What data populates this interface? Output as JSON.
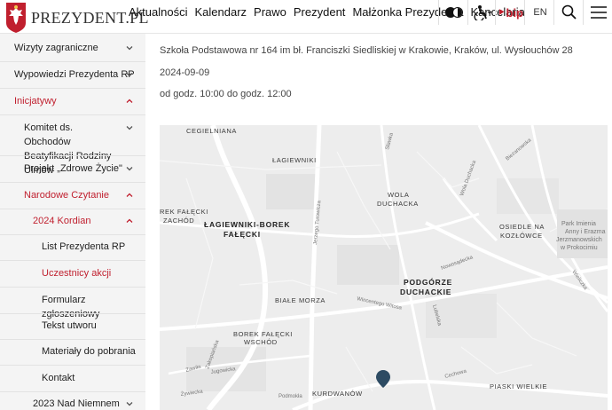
{
  "header": {
    "logo_text": "PREZYDENT.PL",
    "nav": [
      "Aktualności",
      "Kalendarz",
      "Prawo",
      "Prezydent",
      "Małżonka Prezydenta",
      "Kancelaria"
    ],
    "tools": {
      "contrast_icon": "contrast-toggle-icon",
      "accessibility_icon": "accessibility-icon",
      "bip_label": "bip",
      "lang_label": "EN",
      "search_icon": "search-icon",
      "menu_icon": "hamburger-menu-icon"
    },
    "brand_color": "#c01f2e"
  },
  "sidebar": {
    "items": [
      {
        "label": "Wizyty zagraniczne",
        "active": false,
        "chevron": "down"
      },
      {
        "label": "Wypowiedzi Prezydenta RP",
        "active": false,
        "chevron": "down"
      },
      {
        "label": "Inicjatywy",
        "active": true,
        "chevron": "up"
      },
      {
        "label": "Komitet ds. Obchodów Beatyfikacji Rodziny Ulmów",
        "active": false,
        "chevron": "down"
      },
      {
        "label": "Projekt „Zdrowe Życie\"",
        "active": false,
        "chevron": "down"
      },
      {
        "label": "Narodowe Czytanie",
        "active": true,
        "chevron": "up"
      },
      {
        "label": "2024 Kordian",
        "active": true,
        "chevron": "up"
      },
      {
        "label": "List Prezydenta RP",
        "active": false,
        "chevron": null
      },
      {
        "label": "Uczestnicy akcji",
        "active": true,
        "chevron": null
      },
      {
        "label": "Formularz zgłoszeniowy",
        "active": false,
        "chevron": null
      },
      {
        "label": "Tekst utworu",
        "active": false,
        "chevron": null
      },
      {
        "label": "Materiały do pobrania",
        "active": false,
        "chevron": null
      },
      {
        "label": "Kontakt",
        "active": false,
        "chevron": null
      },
      {
        "label": "2023 Nad Niemnem",
        "active": false,
        "chevron": "down"
      }
    ]
  },
  "main": {
    "address": "Szkoła Podstawowa nr 164 im bł. Franciszki Siedliskiej w Krakowie, Kraków, ul. Wysłouchów 28",
    "date": "2024-09-09",
    "time": "od godz. 10:00 do godz. 12:00"
  },
  "map": {
    "districts": [
      "CEGIELNIANA",
      "ŁAGIEWNIKI",
      "WOLA",
      "DUCHACKA",
      "REK FAŁĘCKI",
      "ZACHÓD",
      "ŁAGIEWNIKI-BOREK",
      "FAŁĘCKI",
      "OSIEDLE NA",
      "KOZŁÓWCE",
      "PODGÓRZE",
      "DUCHACKIE",
      "BIAŁE MORZA",
      "BOREK FAŁĘCKI",
      "WSCHÓD",
      "KURDWANÓW",
      "PIASKI WIELKIE"
    ],
    "streets": [
      "Zakopiańska",
      "Jerzego Turowicza",
      "Wincentego Witosa",
      "Nowosądecka",
      "Lubelska",
      "Cechowa",
      "Podmokła",
      "Żywiecka",
      "Jugowicka",
      "Wieliczka",
      "Biezanowska",
      "Wola Duchacka",
      "Zawiła",
      "Sławka"
    ],
    "park": [
      "Park Imienia",
      "Anny i Erazma",
      "Jerzmanowskich",
      "w Prokocimiu"
    ],
    "marker_icon": "map-pin-icon"
  }
}
